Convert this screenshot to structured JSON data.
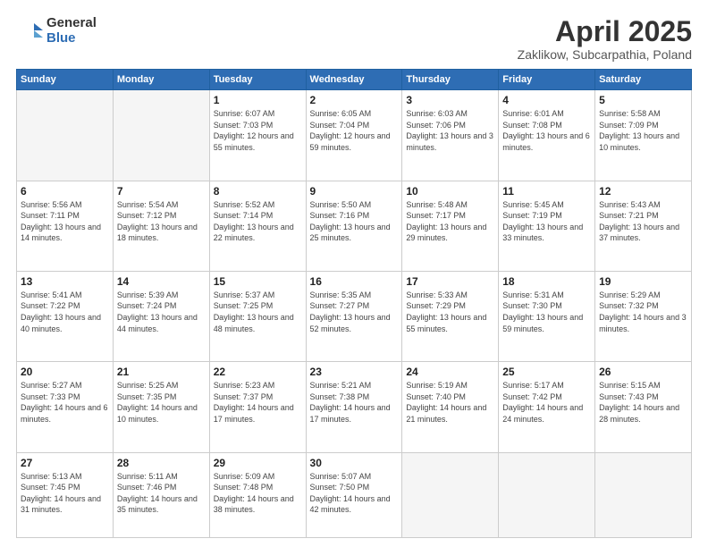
{
  "logo": {
    "general": "General",
    "blue": "Blue"
  },
  "header": {
    "month": "April 2025",
    "location": "Zaklikow, Subcarpathia, Poland"
  },
  "weekdays": [
    "Sunday",
    "Monday",
    "Tuesday",
    "Wednesday",
    "Thursday",
    "Friday",
    "Saturday"
  ],
  "days": [
    {
      "num": "",
      "info": ""
    },
    {
      "num": "",
      "info": ""
    },
    {
      "num": "1",
      "info": "Sunrise: 6:07 AM\nSunset: 7:03 PM\nDaylight: 12 hours and 55 minutes."
    },
    {
      "num": "2",
      "info": "Sunrise: 6:05 AM\nSunset: 7:04 PM\nDaylight: 12 hours and 59 minutes."
    },
    {
      "num": "3",
      "info": "Sunrise: 6:03 AM\nSunset: 7:06 PM\nDaylight: 13 hours and 3 minutes."
    },
    {
      "num": "4",
      "info": "Sunrise: 6:01 AM\nSunset: 7:08 PM\nDaylight: 13 hours and 6 minutes."
    },
    {
      "num": "5",
      "info": "Sunrise: 5:58 AM\nSunset: 7:09 PM\nDaylight: 13 hours and 10 minutes."
    },
    {
      "num": "6",
      "info": "Sunrise: 5:56 AM\nSunset: 7:11 PM\nDaylight: 13 hours and 14 minutes."
    },
    {
      "num": "7",
      "info": "Sunrise: 5:54 AM\nSunset: 7:12 PM\nDaylight: 13 hours and 18 minutes."
    },
    {
      "num": "8",
      "info": "Sunrise: 5:52 AM\nSunset: 7:14 PM\nDaylight: 13 hours and 22 minutes."
    },
    {
      "num": "9",
      "info": "Sunrise: 5:50 AM\nSunset: 7:16 PM\nDaylight: 13 hours and 25 minutes."
    },
    {
      "num": "10",
      "info": "Sunrise: 5:48 AM\nSunset: 7:17 PM\nDaylight: 13 hours and 29 minutes."
    },
    {
      "num": "11",
      "info": "Sunrise: 5:45 AM\nSunset: 7:19 PM\nDaylight: 13 hours and 33 minutes."
    },
    {
      "num": "12",
      "info": "Sunrise: 5:43 AM\nSunset: 7:21 PM\nDaylight: 13 hours and 37 minutes."
    },
    {
      "num": "13",
      "info": "Sunrise: 5:41 AM\nSunset: 7:22 PM\nDaylight: 13 hours and 40 minutes."
    },
    {
      "num": "14",
      "info": "Sunrise: 5:39 AM\nSunset: 7:24 PM\nDaylight: 13 hours and 44 minutes."
    },
    {
      "num": "15",
      "info": "Sunrise: 5:37 AM\nSunset: 7:25 PM\nDaylight: 13 hours and 48 minutes."
    },
    {
      "num": "16",
      "info": "Sunrise: 5:35 AM\nSunset: 7:27 PM\nDaylight: 13 hours and 52 minutes."
    },
    {
      "num": "17",
      "info": "Sunrise: 5:33 AM\nSunset: 7:29 PM\nDaylight: 13 hours and 55 minutes."
    },
    {
      "num": "18",
      "info": "Sunrise: 5:31 AM\nSunset: 7:30 PM\nDaylight: 13 hours and 59 minutes."
    },
    {
      "num": "19",
      "info": "Sunrise: 5:29 AM\nSunset: 7:32 PM\nDaylight: 14 hours and 3 minutes."
    },
    {
      "num": "20",
      "info": "Sunrise: 5:27 AM\nSunset: 7:33 PM\nDaylight: 14 hours and 6 minutes."
    },
    {
      "num": "21",
      "info": "Sunrise: 5:25 AM\nSunset: 7:35 PM\nDaylight: 14 hours and 10 minutes."
    },
    {
      "num": "22",
      "info": "Sunrise: 5:23 AM\nSunset: 7:37 PM\nDaylight: 14 hours and 17 minutes."
    },
    {
      "num": "23",
      "info": "Sunrise: 5:21 AM\nSunset: 7:38 PM\nDaylight: 14 hours and 17 minutes."
    },
    {
      "num": "24",
      "info": "Sunrise: 5:19 AM\nSunset: 7:40 PM\nDaylight: 14 hours and 21 minutes."
    },
    {
      "num": "25",
      "info": "Sunrise: 5:17 AM\nSunset: 7:42 PM\nDaylight: 14 hours and 24 minutes."
    },
    {
      "num": "26",
      "info": "Sunrise: 5:15 AM\nSunset: 7:43 PM\nDaylight: 14 hours and 28 minutes."
    },
    {
      "num": "27",
      "info": "Sunrise: 5:13 AM\nSunset: 7:45 PM\nDaylight: 14 hours and 31 minutes."
    },
    {
      "num": "28",
      "info": "Sunrise: 5:11 AM\nSunset: 7:46 PM\nDaylight: 14 hours and 35 minutes."
    },
    {
      "num": "29",
      "info": "Sunrise: 5:09 AM\nSunset: 7:48 PM\nDaylight: 14 hours and 38 minutes."
    },
    {
      "num": "30",
      "info": "Sunrise: 5:07 AM\nSunset: 7:50 PM\nDaylight: 14 hours and 42 minutes."
    },
    {
      "num": "",
      "info": ""
    },
    {
      "num": "",
      "info": ""
    },
    {
      "num": "",
      "info": ""
    },
    {
      "num": "",
      "info": ""
    }
  ]
}
